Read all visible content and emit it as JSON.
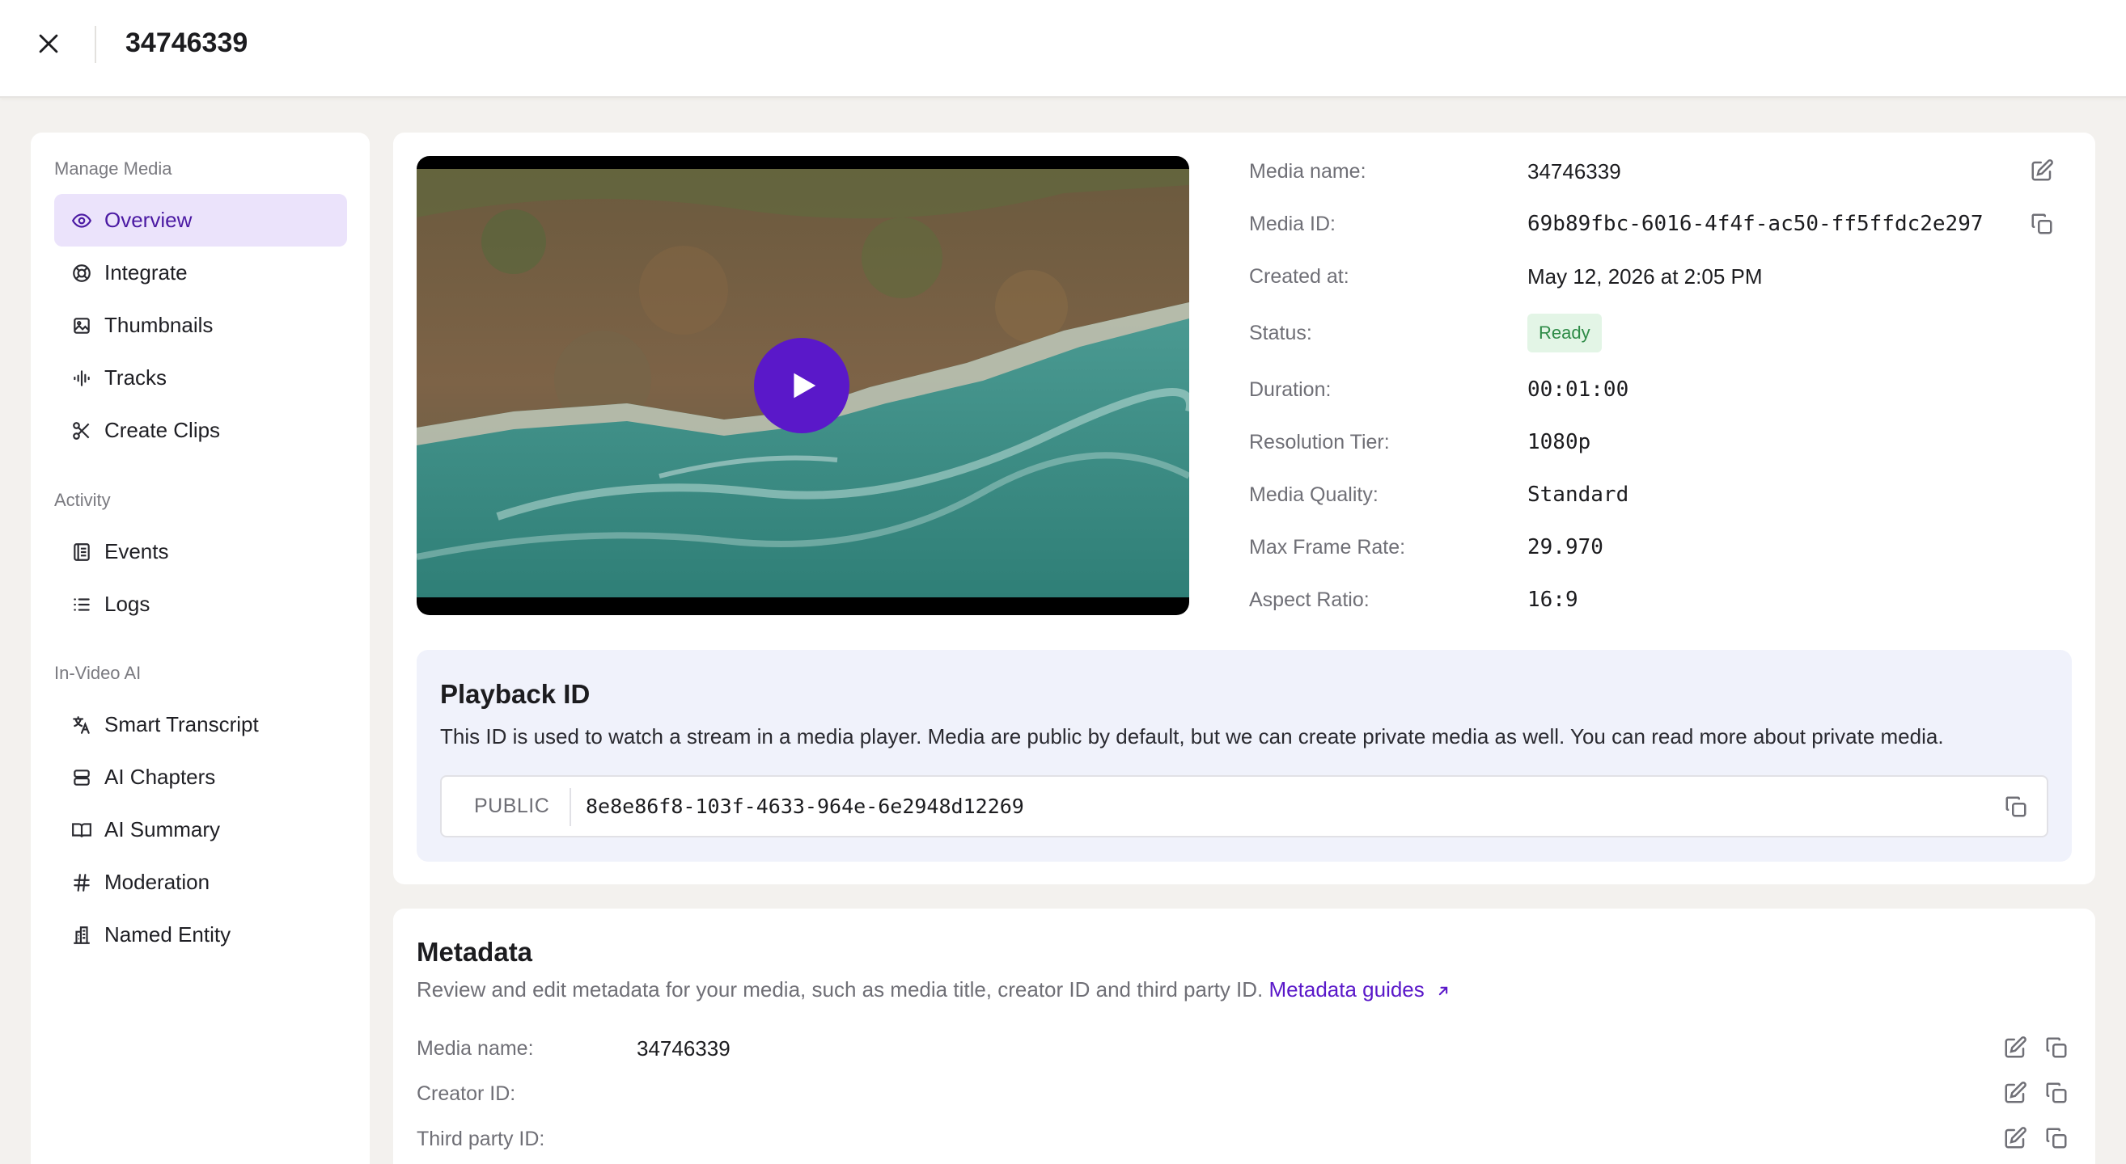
{
  "header": {
    "title": "34746339"
  },
  "sidebar": {
    "sections": [
      {
        "label": "Manage Media",
        "items": [
          {
            "label": "Overview",
            "icon": "eye-icon",
            "active": true
          },
          {
            "label": "Integrate",
            "icon": "lifebuoy-icon"
          },
          {
            "label": "Thumbnails",
            "icon": "image-icon"
          },
          {
            "label": "Tracks",
            "icon": "audio-waveform-icon"
          },
          {
            "label": "Create Clips",
            "icon": "scissors-icon"
          }
        ]
      },
      {
        "label": "Activity",
        "items": [
          {
            "label": "Events",
            "icon": "ledger-icon"
          },
          {
            "label": "Logs",
            "icon": "list-icon"
          }
        ]
      },
      {
        "label": "In-Video AI",
        "items": [
          {
            "label": "Smart Transcript",
            "icon": "translate-icon"
          },
          {
            "label": "AI Chapters",
            "icon": "stack-icon"
          },
          {
            "label": "AI Summary",
            "icon": "book-icon"
          },
          {
            "label": "Moderation",
            "icon": "hash-icon"
          },
          {
            "label": "Named Entity",
            "icon": "building-icon"
          }
        ]
      }
    ]
  },
  "media_info": {
    "media_name": {
      "label": "Media name:",
      "value": "34746339"
    },
    "media_id": {
      "label": "Media ID:",
      "value": "69b89fbc-6016-4f4f-ac50-ff5ffdc2e297"
    },
    "created_at": {
      "label": "Created at:",
      "value": "May 12, 2026 at 2:05 PM"
    },
    "status": {
      "label": "Status:",
      "value": "Ready"
    },
    "duration": {
      "label": "Duration:",
      "value": "00:01:00"
    },
    "resolution_tier": {
      "label": "Resolution Tier:",
      "value": "1080p"
    },
    "media_quality": {
      "label": "Media Quality:",
      "value": "Standard"
    },
    "max_frame_rate": {
      "label": "Max Frame Rate:",
      "value": "29.970"
    },
    "aspect_ratio": {
      "label": "Aspect Ratio:",
      "value": "16:9"
    }
  },
  "playback": {
    "title": "Playback ID",
    "description": "This ID is used to watch a stream in a media player. Media are public by default, but we can create private media as well. You can read more about private media.",
    "policy": "PUBLIC",
    "id": "8e8e86f8-103f-4633-964e-6e2948d12269"
  },
  "metadata": {
    "title": "Metadata",
    "description": "Review and edit metadata for your media, such as media title, creator ID and third party ID.",
    "link_label": "Metadata guides",
    "fields": [
      {
        "label": "Media name:",
        "value": "34746339"
      },
      {
        "label": "Creator ID:",
        "value": ""
      },
      {
        "label": "Third party ID:",
        "value": ""
      }
    ]
  },
  "colors": {
    "accent": "#5a18c9",
    "active_nav_bg": "#ebe3fb",
    "status_ready_bg": "#e3f5e6",
    "status_ready_text": "#2e8b47",
    "playback_bg": "#f0f2fb"
  }
}
